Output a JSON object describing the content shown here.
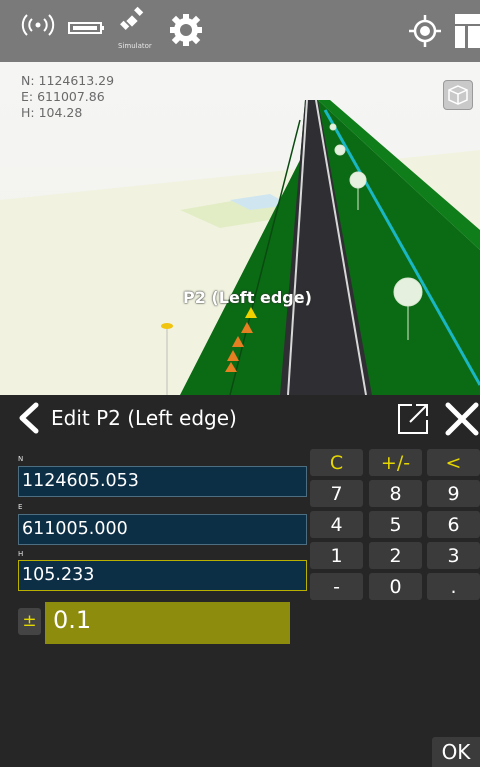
{
  "toolbar": {
    "icons": [
      "radio-signal-icon",
      "battery-icon",
      "satellite-icon",
      "settings-gear-icon",
      "gps-target-icon",
      "layers-icon"
    ],
    "simulator_label": "Simulator"
  },
  "coordinates": {
    "n": "N: 1124613.29",
    "e": "E: 611007.86",
    "h": "H: 104.28"
  },
  "scene": {
    "point_label": "P2 (Left edge)",
    "view_button_icon": "cube-view-icon"
  },
  "panel": {
    "title": "Edit  P2 (Left edge)",
    "fields": {
      "n_label": "N",
      "n_value": "1124605.053",
      "e_label": "E",
      "e_value": "611005.000",
      "h_label": "H",
      "h_value": "105.233"
    },
    "tolerance": {
      "sign": "±",
      "value": "0.1"
    },
    "keypad": {
      "row1": [
        "C",
        "+/-",
        "<"
      ],
      "row2": [
        "7",
        "8",
        "9"
      ],
      "row3": [
        "4",
        "5",
        "6"
      ],
      "row4": [
        "1",
        "2",
        "3"
      ],
      "row5": [
        "-",
        "0",
        "."
      ]
    },
    "ok_label": "OK"
  },
  "colors": {
    "field_bg": "#0c2f46",
    "accent_yellow": "#e6d700",
    "tolerance_bg": "#8e8c0c",
    "terrain_green": "#0b6b14"
  }
}
